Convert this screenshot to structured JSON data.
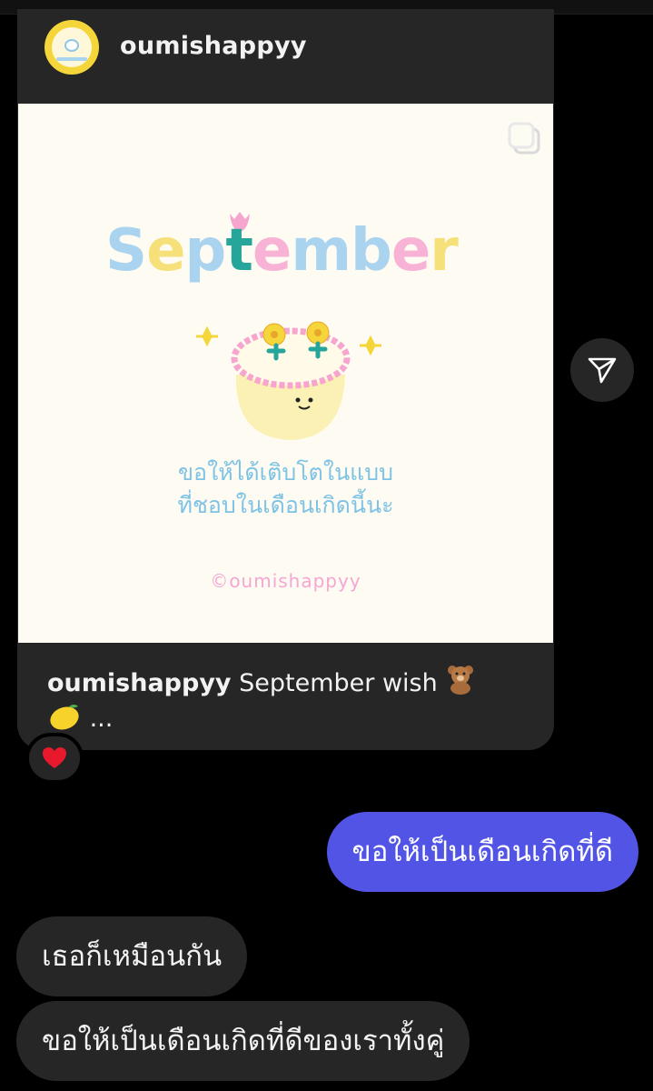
{
  "post": {
    "username": "oumishappyy",
    "image": {
      "title": "September",
      "title_letters": [
        {
          "ch": "S",
          "color": "#a9d3ef"
        },
        {
          "ch": "e",
          "color": "#f5e07a"
        },
        {
          "ch": "p",
          "color": "#a9d3ef"
        },
        {
          "ch": "t",
          "color": "#26a69a"
        },
        {
          "ch": "e",
          "color": "#f7b2d6"
        },
        {
          "ch": "m",
          "color": "#a9d3ef"
        },
        {
          "ch": "b",
          "color": "#a9d3ef"
        },
        {
          "ch": "e",
          "color": "#f7b2d6"
        },
        {
          "ch": "r",
          "color": "#f5e07a"
        }
      ],
      "wish_line1": "ขอให้ได้เติบโตในแบบ",
      "wish_line2": "ที่ชอบในเดือนเกิดนี้นะ",
      "credit": "©oumishappyy"
    },
    "caption": {
      "username": "oumishappyy",
      "text": "September wish",
      "more": "...",
      "emoji_icons": [
        "teddy-bear-icon",
        "lemon-icon"
      ]
    },
    "reaction_icon": "heart-icon",
    "multi_image_icon": "carousel-icon"
  },
  "share_icon": "send-icon",
  "messages": [
    {
      "side": "sent",
      "text": "ขอให้เป็นเดือนเกิดที่ดี"
    },
    {
      "side": "received",
      "text": "เธอก็เหมือนกัน"
    },
    {
      "side": "received",
      "text": "ขอให้เป็นเดือนเกิดที่ดีของเราทั้งคู่"
    }
  ],
  "colors": {
    "background": "#000000",
    "card": "#262626",
    "sent_bubble": "#5254e6",
    "received_bubble": "#262626",
    "image_background": "#fdfbf2",
    "wish_text": "#7ec3e6",
    "credit_text": "#f6a6d2",
    "avatar_ring": "#f5d63a"
  }
}
